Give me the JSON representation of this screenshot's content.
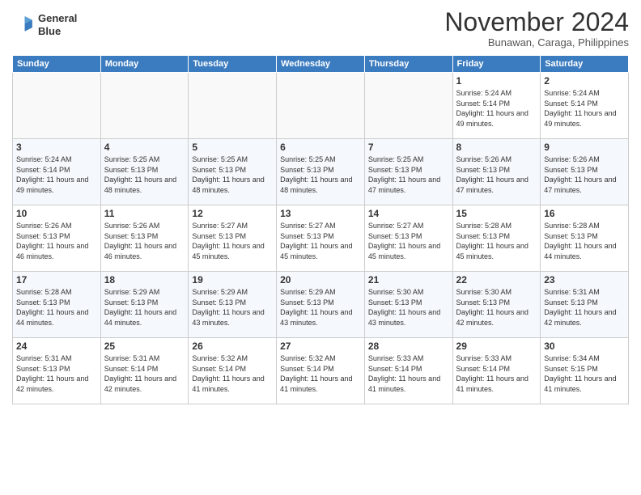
{
  "header": {
    "logo_line1": "General",
    "logo_line2": "Blue",
    "month": "November 2024",
    "location": "Bunawan, Caraga, Philippines"
  },
  "weekdays": [
    "Sunday",
    "Monday",
    "Tuesday",
    "Wednesday",
    "Thursday",
    "Friday",
    "Saturday"
  ],
  "weeks": [
    [
      {
        "day": "",
        "sunrise": "",
        "sunset": "",
        "daylight": ""
      },
      {
        "day": "",
        "sunrise": "",
        "sunset": "",
        "daylight": ""
      },
      {
        "day": "",
        "sunrise": "",
        "sunset": "",
        "daylight": ""
      },
      {
        "day": "",
        "sunrise": "",
        "sunset": "",
        "daylight": ""
      },
      {
        "day": "",
        "sunrise": "",
        "sunset": "",
        "daylight": ""
      },
      {
        "day": "1",
        "sunrise": "Sunrise: 5:24 AM",
        "sunset": "Sunset: 5:14 PM",
        "daylight": "Daylight: 11 hours and 49 minutes."
      },
      {
        "day": "2",
        "sunrise": "Sunrise: 5:24 AM",
        "sunset": "Sunset: 5:14 PM",
        "daylight": "Daylight: 11 hours and 49 minutes."
      }
    ],
    [
      {
        "day": "3",
        "sunrise": "Sunrise: 5:24 AM",
        "sunset": "Sunset: 5:14 PM",
        "daylight": "Daylight: 11 hours and 49 minutes."
      },
      {
        "day": "4",
        "sunrise": "Sunrise: 5:25 AM",
        "sunset": "Sunset: 5:13 PM",
        "daylight": "Daylight: 11 hours and 48 minutes."
      },
      {
        "day": "5",
        "sunrise": "Sunrise: 5:25 AM",
        "sunset": "Sunset: 5:13 PM",
        "daylight": "Daylight: 11 hours and 48 minutes."
      },
      {
        "day": "6",
        "sunrise": "Sunrise: 5:25 AM",
        "sunset": "Sunset: 5:13 PM",
        "daylight": "Daylight: 11 hours and 48 minutes."
      },
      {
        "day": "7",
        "sunrise": "Sunrise: 5:25 AM",
        "sunset": "Sunset: 5:13 PM",
        "daylight": "Daylight: 11 hours and 47 minutes."
      },
      {
        "day": "8",
        "sunrise": "Sunrise: 5:26 AM",
        "sunset": "Sunset: 5:13 PM",
        "daylight": "Daylight: 11 hours and 47 minutes."
      },
      {
        "day": "9",
        "sunrise": "Sunrise: 5:26 AM",
        "sunset": "Sunset: 5:13 PM",
        "daylight": "Daylight: 11 hours and 47 minutes."
      }
    ],
    [
      {
        "day": "10",
        "sunrise": "Sunrise: 5:26 AM",
        "sunset": "Sunset: 5:13 PM",
        "daylight": "Daylight: 11 hours and 46 minutes."
      },
      {
        "day": "11",
        "sunrise": "Sunrise: 5:26 AM",
        "sunset": "Sunset: 5:13 PM",
        "daylight": "Daylight: 11 hours and 46 minutes."
      },
      {
        "day": "12",
        "sunrise": "Sunrise: 5:27 AM",
        "sunset": "Sunset: 5:13 PM",
        "daylight": "Daylight: 11 hours and 45 minutes."
      },
      {
        "day": "13",
        "sunrise": "Sunrise: 5:27 AM",
        "sunset": "Sunset: 5:13 PM",
        "daylight": "Daylight: 11 hours and 45 minutes."
      },
      {
        "day": "14",
        "sunrise": "Sunrise: 5:27 AM",
        "sunset": "Sunset: 5:13 PM",
        "daylight": "Daylight: 11 hours and 45 minutes."
      },
      {
        "day": "15",
        "sunrise": "Sunrise: 5:28 AM",
        "sunset": "Sunset: 5:13 PM",
        "daylight": "Daylight: 11 hours and 45 minutes."
      },
      {
        "day": "16",
        "sunrise": "Sunrise: 5:28 AM",
        "sunset": "Sunset: 5:13 PM",
        "daylight": "Daylight: 11 hours and 44 minutes."
      }
    ],
    [
      {
        "day": "17",
        "sunrise": "Sunrise: 5:28 AM",
        "sunset": "Sunset: 5:13 PM",
        "daylight": "Daylight: 11 hours and 44 minutes."
      },
      {
        "day": "18",
        "sunrise": "Sunrise: 5:29 AM",
        "sunset": "Sunset: 5:13 PM",
        "daylight": "Daylight: 11 hours and 44 minutes."
      },
      {
        "day": "19",
        "sunrise": "Sunrise: 5:29 AM",
        "sunset": "Sunset: 5:13 PM",
        "daylight": "Daylight: 11 hours and 43 minutes."
      },
      {
        "day": "20",
        "sunrise": "Sunrise: 5:29 AM",
        "sunset": "Sunset: 5:13 PM",
        "daylight": "Daylight: 11 hours and 43 minutes."
      },
      {
        "day": "21",
        "sunrise": "Sunrise: 5:30 AM",
        "sunset": "Sunset: 5:13 PM",
        "daylight": "Daylight: 11 hours and 43 minutes."
      },
      {
        "day": "22",
        "sunrise": "Sunrise: 5:30 AM",
        "sunset": "Sunset: 5:13 PM",
        "daylight": "Daylight: 11 hours and 42 minutes."
      },
      {
        "day": "23",
        "sunrise": "Sunrise: 5:31 AM",
        "sunset": "Sunset: 5:13 PM",
        "daylight": "Daylight: 11 hours and 42 minutes."
      }
    ],
    [
      {
        "day": "24",
        "sunrise": "Sunrise: 5:31 AM",
        "sunset": "Sunset: 5:13 PM",
        "daylight": "Daylight: 11 hours and 42 minutes."
      },
      {
        "day": "25",
        "sunrise": "Sunrise: 5:31 AM",
        "sunset": "Sunset: 5:14 PM",
        "daylight": "Daylight: 11 hours and 42 minutes."
      },
      {
        "day": "26",
        "sunrise": "Sunrise: 5:32 AM",
        "sunset": "Sunset: 5:14 PM",
        "daylight": "Daylight: 11 hours and 41 minutes."
      },
      {
        "day": "27",
        "sunrise": "Sunrise: 5:32 AM",
        "sunset": "Sunset: 5:14 PM",
        "daylight": "Daylight: 11 hours and 41 minutes."
      },
      {
        "day": "28",
        "sunrise": "Sunrise: 5:33 AM",
        "sunset": "Sunset: 5:14 PM",
        "daylight": "Daylight: 11 hours and 41 minutes."
      },
      {
        "day": "29",
        "sunrise": "Sunrise: 5:33 AM",
        "sunset": "Sunset: 5:14 PM",
        "daylight": "Daylight: 11 hours and 41 minutes."
      },
      {
        "day": "30",
        "sunrise": "Sunrise: 5:34 AM",
        "sunset": "Sunset: 5:15 PM",
        "daylight": "Daylight: 11 hours and 41 minutes."
      }
    ]
  ]
}
